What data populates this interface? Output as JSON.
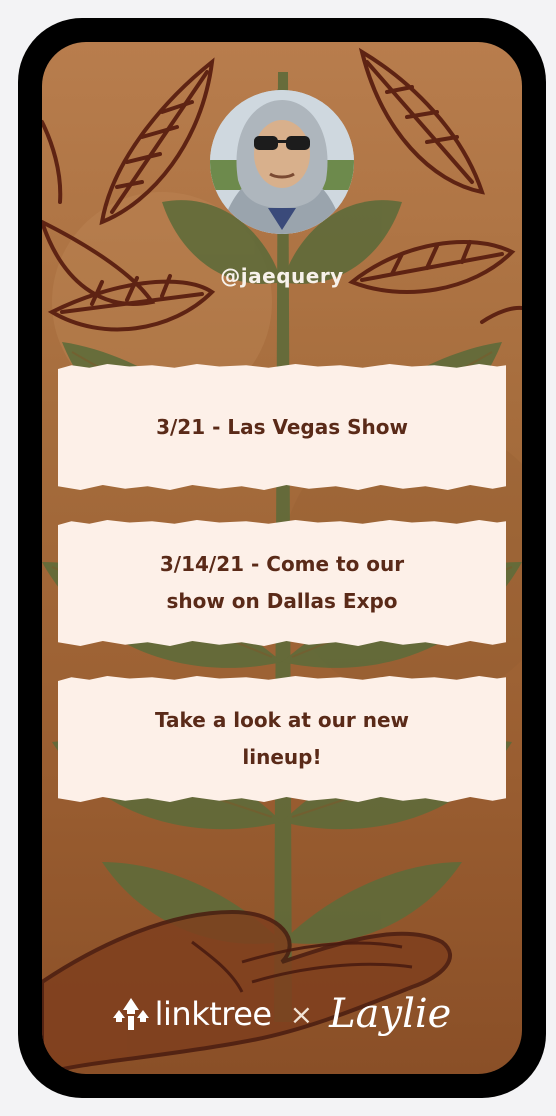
{
  "profile": {
    "handle": "@jaequery",
    "avatar_icon": "profile-photo"
  },
  "links": [
    {
      "label": "3/21 - Las Vegas Show"
    },
    {
      "label": "3/14/21 - Come to our show on Dallas Expo"
    },
    {
      "label": "Take a look at our new lineup!"
    }
  ],
  "footer": {
    "brand": "linktree",
    "separator": "×",
    "partner": "Laylie"
  },
  "colors": {
    "background": "#a56c3c",
    "card": "#fdf0e8",
    "card_text": "#5a2a18",
    "leaf_outline": "#5e2313",
    "leaf_green": "#5f6b3a"
  }
}
